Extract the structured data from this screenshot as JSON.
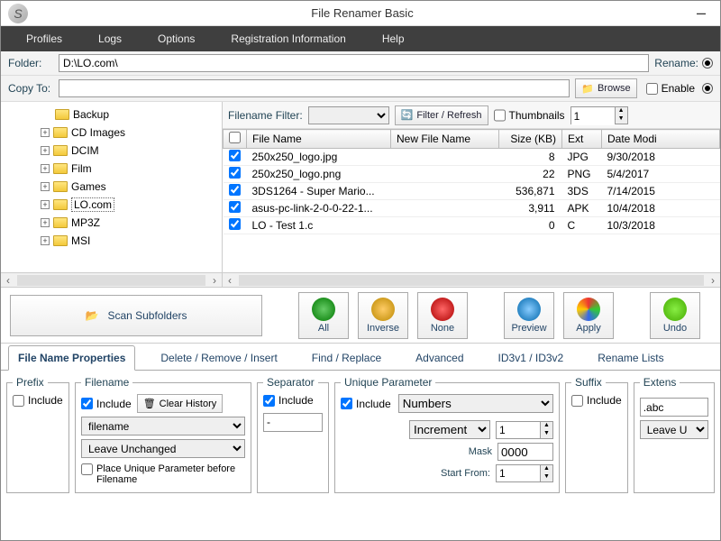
{
  "window": {
    "title": "File Renamer Basic"
  },
  "menu": {
    "profiles": "Profiles",
    "logs": "Logs",
    "options": "Options",
    "reg": "Registration Information",
    "help": "Help"
  },
  "folderbar": {
    "label": "Folder:",
    "path": "D:\\LO.com\\",
    "rename": "Rename:"
  },
  "copybar": {
    "label": "Copy To:",
    "path": "",
    "browse": "Browse",
    "enable": "Enable"
  },
  "tree": {
    "items": [
      {
        "name": "Backup",
        "expander": ""
      },
      {
        "name": "CD Images",
        "expander": "+"
      },
      {
        "name": "DCIM",
        "expander": "+"
      },
      {
        "name": "Film",
        "expander": "+"
      },
      {
        "name": "Games",
        "expander": "+"
      },
      {
        "name": "LO.com",
        "expander": "+",
        "selected": true
      },
      {
        "name": "MP3Z",
        "expander": "+"
      },
      {
        "name": "MSI",
        "expander": "+"
      }
    ]
  },
  "filter": {
    "label": "Filename Filter:",
    "value": "",
    "refresh": "Filter / Refresh",
    "thumb": "Thumbnails",
    "num": "1"
  },
  "grid": {
    "headers": {
      "chk": "",
      "name": "File Name",
      "new": "New File Name",
      "size": "Size (KB)",
      "ext": "Ext",
      "date": "Date Modi"
    },
    "rows": [
      {
        "name": "250x250_logo.jpg",
        "new": "",
        "size": "8",
        "ext": "JPG",
        "date": "9/30/2018"
      },
      {
        "name": "250x250_logo.png",
        "new": "",
        "size": "22",
        "ext": "PNG",
        "date": "5/4/2017"
      },
      {
        "name": "3DS1264 - Super Mario...",
        "new": "",
        "size": "536,871",
        "ext": "3DS",
        "date": "7/14/2015"
      },
      {
        "name": "asus-pc-link-2-0-0-22-1...",
        "new": "",
        "size": "3,911",
        "ext": "APK",
        "date": "10/4/2018"
      },
      {
        "name": "LO - Test 1.c",
        "new": "",
        "size": "0",
        "ext": "C",
        "date": "10/3/2018"
      }
    ]
  },
  "midbtns": {
    "scan": "Scan Subfolders",
    "all": "All",
    "inverse": "Inverse",
    "none": "None",
    "preview": "Preview",
    "apply": "Apply",
    "undo": "Undo"
  },
  "tabs": {
    "props": "File Name Properties",
    "delete": "Delete / Remove / Insert",
    "find": "Find / Replace",
    "adv": "Advanced",
    "id3": "ID3v1 / ID3v2",
    "lists": "Rename Lists"
  },
  "panel": {
    "prefix": {
      "legend": "Prefix",
      "include": "Include"
    },
    "filename": {
      "legend": "Filename",
      "include": "Include",
      "clear": "Clear History",
      "sel1": "filename",
      "sel2": "Leave Unchanged",
      "place": "Place Unique Parameter before Filename"
    },
    "separator": {
      "legend": "Separator",
      "include": "Include",
      "val": "-"
    },
    "unique": {
      "legend": "Unique Parameter",
      "include": "Include",
      "type": "Numbers",
      "mode": "Increment",
      "step": "1",
      "maskLbl": "Mask",
      "mask": "0000",
      "startLbl": "Start From:",
      "start": "1"
    },
    "suffix": {
      "legend": "Suffix",
      "include": "Include"
    },
    "ext": {
      "legend": "Extens",
      "val": ".abc",
      "sel": "Leave U"
    }
  }
}
